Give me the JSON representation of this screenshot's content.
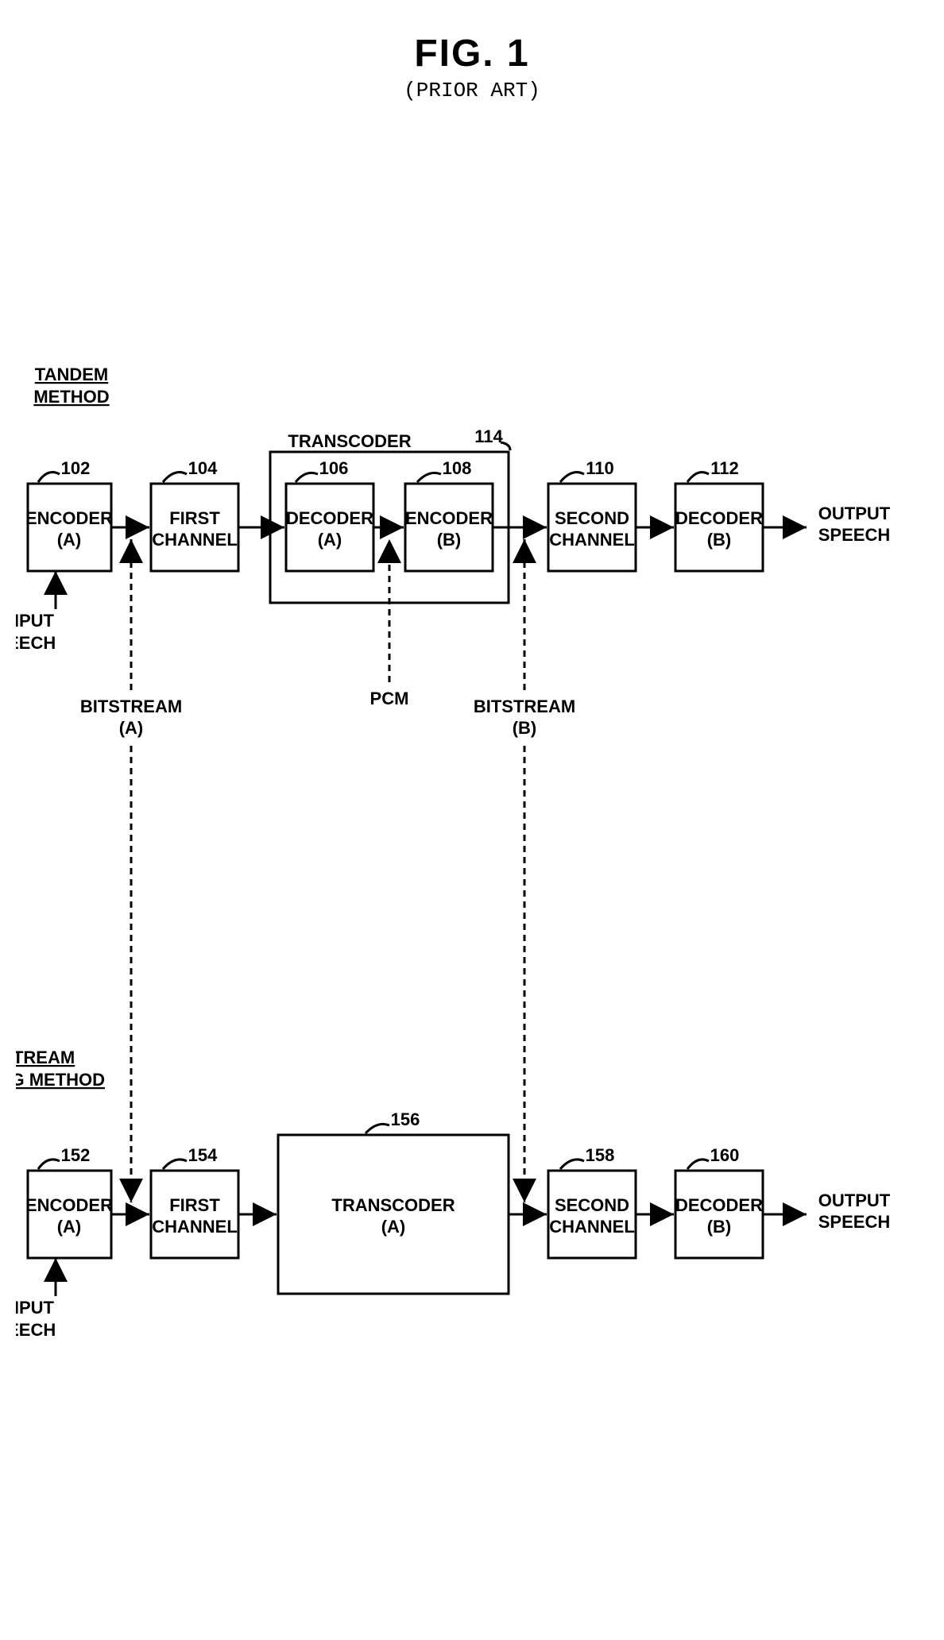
{
  "figure": {
    "title": "FIG. 1",
    "subtitle": "(PRIOR ART)"
  },
  "labels": {
    "tandem_method": "TANDEM",
    "tandem_method2": "METHOD",
    "bitstream_mapping": "BITSTREAM",
    "bitstream_mapping2": "MAPPING METHOD",
    "input_speech1": "INPUT",
    "input_speech2": "SPEECH",
    "output_speech1": "OUTPUT",
    "output_speech2": "SPEECH",
    "bitstream_a1": "BITSTREAM",
    "bitstream_a2": "(A)",
    "bitstream_b1": "BITSTREAM",
    "bitstream_b2": "(B)",
    "pcm": "PCM",
    "transcoder_title": "TRANSCODER"
  },
  "blocks": {
    "encoder_a_top": {
      "line1": "ENCODER",
      "line2": "(A)",
      "ref": "102"
    },
    "first_channel_top": {
      "line1": "FIRST",
      "line2": "CHANNEL",
      "ref": "104"
    },
    "decoder_a": {
      "line1": "DECODER",
      "line2": "(A)",
      "ref": "106"
    },
    "encoder_b": {
      "line1": "ENCODER",
      "line2": "(B)",
      "ref": "108"
    },
    "second_channel_top": {
      "line1": "SECOND",
      "line2": "CHANNEL",
      "ref": "110"
    },
    "decoder_b_top": {
      "line1": "DECODER",
      "line2": "(B)",
      "ref": "112"
    },
    "transcoder_container": {
      "ref": "114"
    },
    "encoder_a_bot": {
      "line1": "ENCODER",
      "line2": "(A)",
      "ref": "152"
    },
    "first_channel_bot": {
      "line1": "FIRST",
      "line2": "CHANNEL",
      "ref": "154"
    },
    "transcoder_a": {
      "line1": "TRANSCODER",
      "line2": "(A)",
      "ref": "156"
    },
    "second_channel_bot": {
      "line1": "SECOND",
      "line2": "CHANNEL",
      "ref": "158"
    },
    "decoder_b_bot": {
      "line1": "DECODER",
      "line2": "(B)",
      "ref": "160"
    }
  }
}
